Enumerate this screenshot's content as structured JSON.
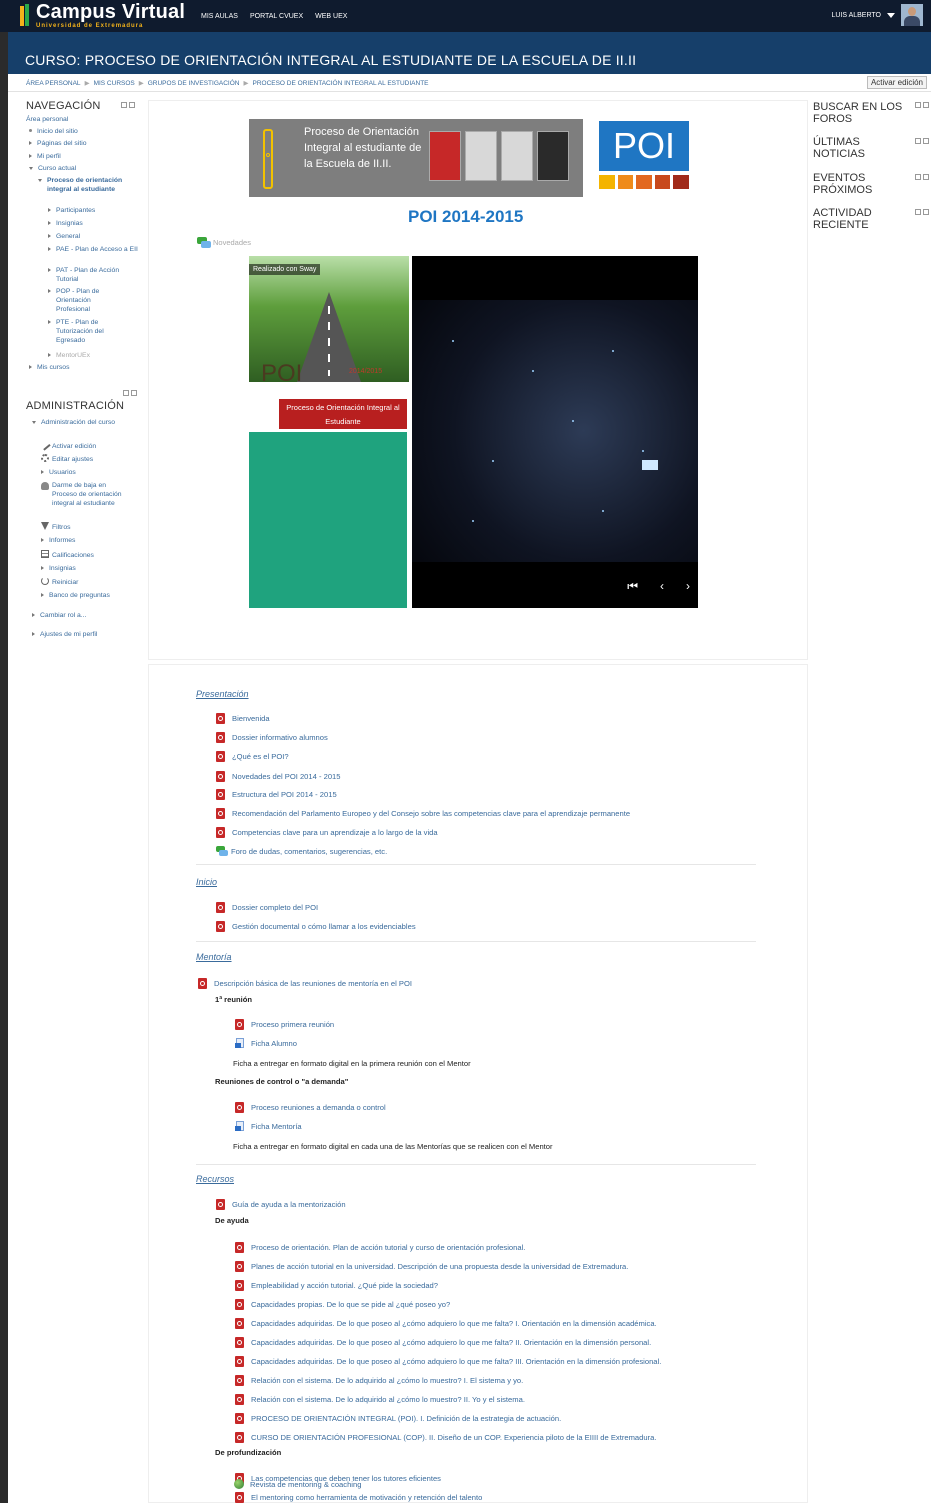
{
  "header": {
    "logo_title": "Campus Virtual",
    "logo_subtitle": "Universidad de Extremadura",
    "nav": [
      "MIS AULAS",
      "PORTAL CVUEX",
      "WEB UEX"
    ],
    "user": "LUIS ALBERTO"
  },
  "course": {
    "title": "CURSO: PROCESO DE ORIENTACIÓN INTEGRAL AL ESTUDIANTE DE LA ESCUELA DE II.II",
    "breadcrumb": [
      "ÁREA PERSONAL",
      "MIS CURSOS",
      "GRUPOS DE INVESTIGACIÓN",
      "PROCESO DE ORIENTACIÓN INTEGRAL AL ESTUDIANTE"
    ],
    "edit_button": "Activar edición"
  },
  "navigation": {
    "title": "NAVEGACIÓN",
    "area_personal": "Área personal",
    "inicio_sitio": "Inicio del sitio",
    "paginas": "Páginas del sitio",
    "perfil": "Mi perfil",
    "curso_actual": "Curso actual",
    "course_name": "Proceso de orientación integral al estudiante",
    "participantes": "Participantes",
    "insignias": "Insignias",
    "general": "General",
    "pae": "PAE - Plan de Acceso a EII",
    "pat": "PAT - Plan de Acción Tutorial",
    "pop": "POP - Plan de Orientación Profesional",
    "pte": "PTE - Plan de Tutorización del Egresado",
    "mentor": "MentorUEx",
    "mis_cursos": "Mis cursos"
  },
  "admin": {
    "title": "ADMINISTRACIÓN",
    "admin_curso": "Administración del curso",
    "activar": "Activar edición",
    "editar": "Editar ajustes",
    "usuarios": "Usuarios",
    "baja": "Darme de baja en Proceso de orientación integral al estudiante",
    "filtros": "Filtros",
    "informes": "Informes",
    "calificaciones": "Calificaciones",
    "insignias": "Insignias",
    "reiniciar": "Reiniciar",
    "banco": "Banco de preguntas",
    "cambiar_rol": "Cambiar rol a...",
    "ajustes_perfil": "Ajustes de mi perfil"
  },
  "right": {
    "buscar": "BUSCAR EN LOS FOROS",
    "noticias": "ÚLTIMAS NOTICIAS",
    "eventos": "EVENTOS PRÓXIMOS",
    "actividad": "ACTIVIDAD RECIENTE"
  },
  "banner": {
    "text": "Proceso de Orientación Integral al estudiante de la Escuela de II.II.",
    "logo": "POI",
    "heading": "POI 2014-2015",
    "news": "Novedades"
  },
  "sway": {
    "tag": "Realizado con Sway",
    "poi": "POI",
    "year": "2014/2015",
    "red_label": "Proceso de Orientación Integral al Estudiante"
  },
  "presentacion": {
    "title": "Presentación",
    "items": [
      "Bienvenida",
      "Dossier informativo alumnos",
      "¿Qué es el POI?",
      "Novedades del POI 2014 - 2015",
      "Estructura del POI 2014 - 2015",
      "Recomendación del Parlamento Europeo y del Consejo sobre las competencias clave para el aprendizaje permanente",
      "Competencias clave para un aprendizaje a lo largo de la vida",
      "Foro de dudas, comentarios, sugerencias, etc."
    ]
  },
  "inicio": {
    "title": "Inicio",
    "items": [
      "Dossier completo del POI",
      "Gestión documental o cómo llamar a los evidenciables"
    ]
  },
  "mentoria": {
    "title": "Mentoría",
    "desc": "Descripción básica de las reuniones de mentoría en el POI",
    "reunion1": "1ª reunión",
    "proc1": "Proceso primera reunión",
    "ficha_alumno": "Ficha Alumno",
    "nota1": "Ficha a entregar en formato digital en la primera reunión con el Mentor",
    "control": "Reuniones de control o \"a demanda\"",
    "proc2": "Proceso reuniones a demanda o control",
    "ficha_mentoria": "Ficha Mentoría",
    "nota2": "Ficha a entregar en formato digital en cada una de las Mentorías que se realicen con el Mentor"
  },
  "recursos": {
    "title": "Recursos",
    "guia": "Guía de ayuda a la mentorización",
    "ayuda_label": "De ayuda",
    "ayuda": [
      "Proceso de orientación. Plan de acción tutorial y curso de orientación profesional.",
      "Planes de acción tutorial en la universidad. Descripción de una propuesta desde la universidad de Extremadura.",
      "Empleabilidad y acción tutorial. ¿Qué pide la sociedad?",
      "Capacidades propias. De lo que se pide al ¿qué poseo yo?",
      "Capacidades adquiridas. De lo que poseo al ¿cómo adquiero lo que me falta? I. Orientación en la dimensión académica.",
      "Capacidades adquiridas. De lo que poseo al ¿cómo adquiero lo que me falta? II. Orientación en la dimensión personal.",
      "Capacidades adquiridas. De lo que poseo al ¿cómo adquiero lo que me falta? III. Orientación en la dimensión profesional.",
      "Relación con el sistema. De lo adquirido al ¿cómo lo muestro? I. El sistema y yo.",
      "Relación con el sistema. De lo adquirido al ¿cómo lo muestro? II. Yo y el sistema.",
      "PROCESO DE ORIENTACIÓN INTEGRAL (POI). I. Definición de la estrategia de actuación.",
      "CURSO DE ORIENTACIÓN PROFESIONAL (COP). II. Diseño de un COP. Experiencia piloto de la EIIII de Extremadura."
    ],
    "prof_label": "De profundización",
    "prof": [
      "Las competencias que deben tener los tutores eficientes",
      "El mentoring como herramienta de motivación y retención del talento",
      "Revista de mentoring & coaching"
    ]
  }
}
